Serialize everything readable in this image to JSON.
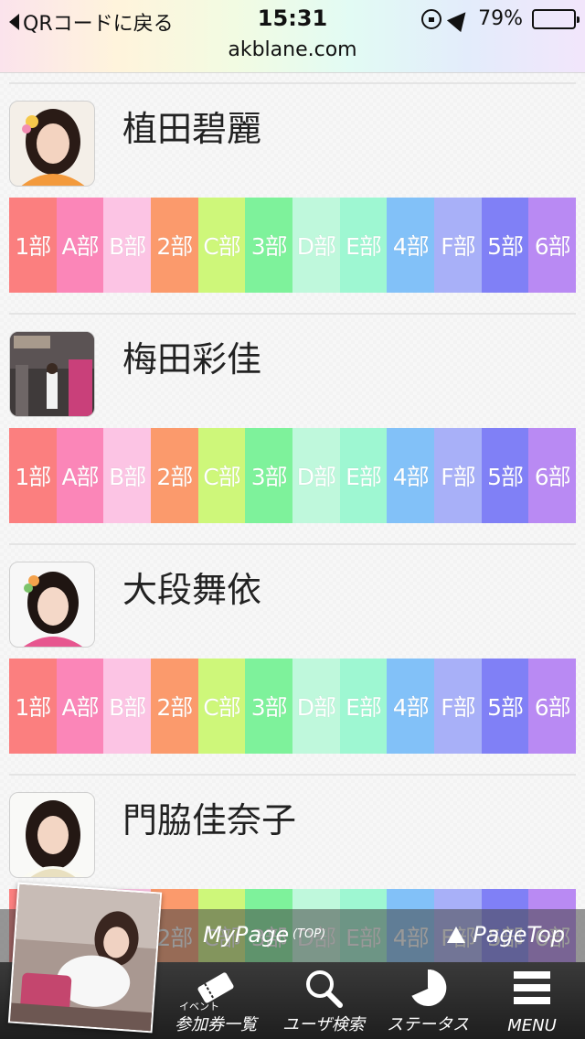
{
  "status_bar": {
    "back_label": "QRコードに戻る",
    "time": "15:31",
    "url": "akblane.com",
    "battery": "79%",
    "battery_level": 0.79
  },
  "ticket_labels": [
    "1部",
    "A部",
    "B部",
    "2部",
    "C部",
    "3部",
    "D部",
    "E部",
    "4部",
    "F部",
    "5部",
    "6部"
  ],
  "ticket_colors": [
    "#fb7f7f",
    "#fb86b8",
    "#fcc4e4",
    "#fb9a6c",
    "#cef77a",
    "#7ef29b",
    "#bff8dc",
    "#9ef7d2",
    "#82c1f8",
    "#a8b0f8",
    "#8080f6",
    "#b98af3"
  ],
  "members": [
    {
      "name": "植田碧麗"
    },
    {
      "name": "梅田彩佳"
    },
    {
      "name": "大段舞依"
    },
    {
      "name": "門脇佳奈子"
    }
  ],
  "bottom": {
    "mypage": "MyPage",
    "mypage_sub": "(TOP)",
    "pagetop": "PageTop"
  },
  "tabs": [
    {
      "label": "参加券一覧",
      "sup": "イベント",
      "icon": "ticket-icon"
    },
    {
      "label": "ユーザ検索",
      "icon": "search-icon"
    },
    {
      "label": "ステータス",
      "icon": "pie-chart-icon"
    },
    {
      "label": "MENU",
      "icon": "menu-icon"
    }
  ]
}
